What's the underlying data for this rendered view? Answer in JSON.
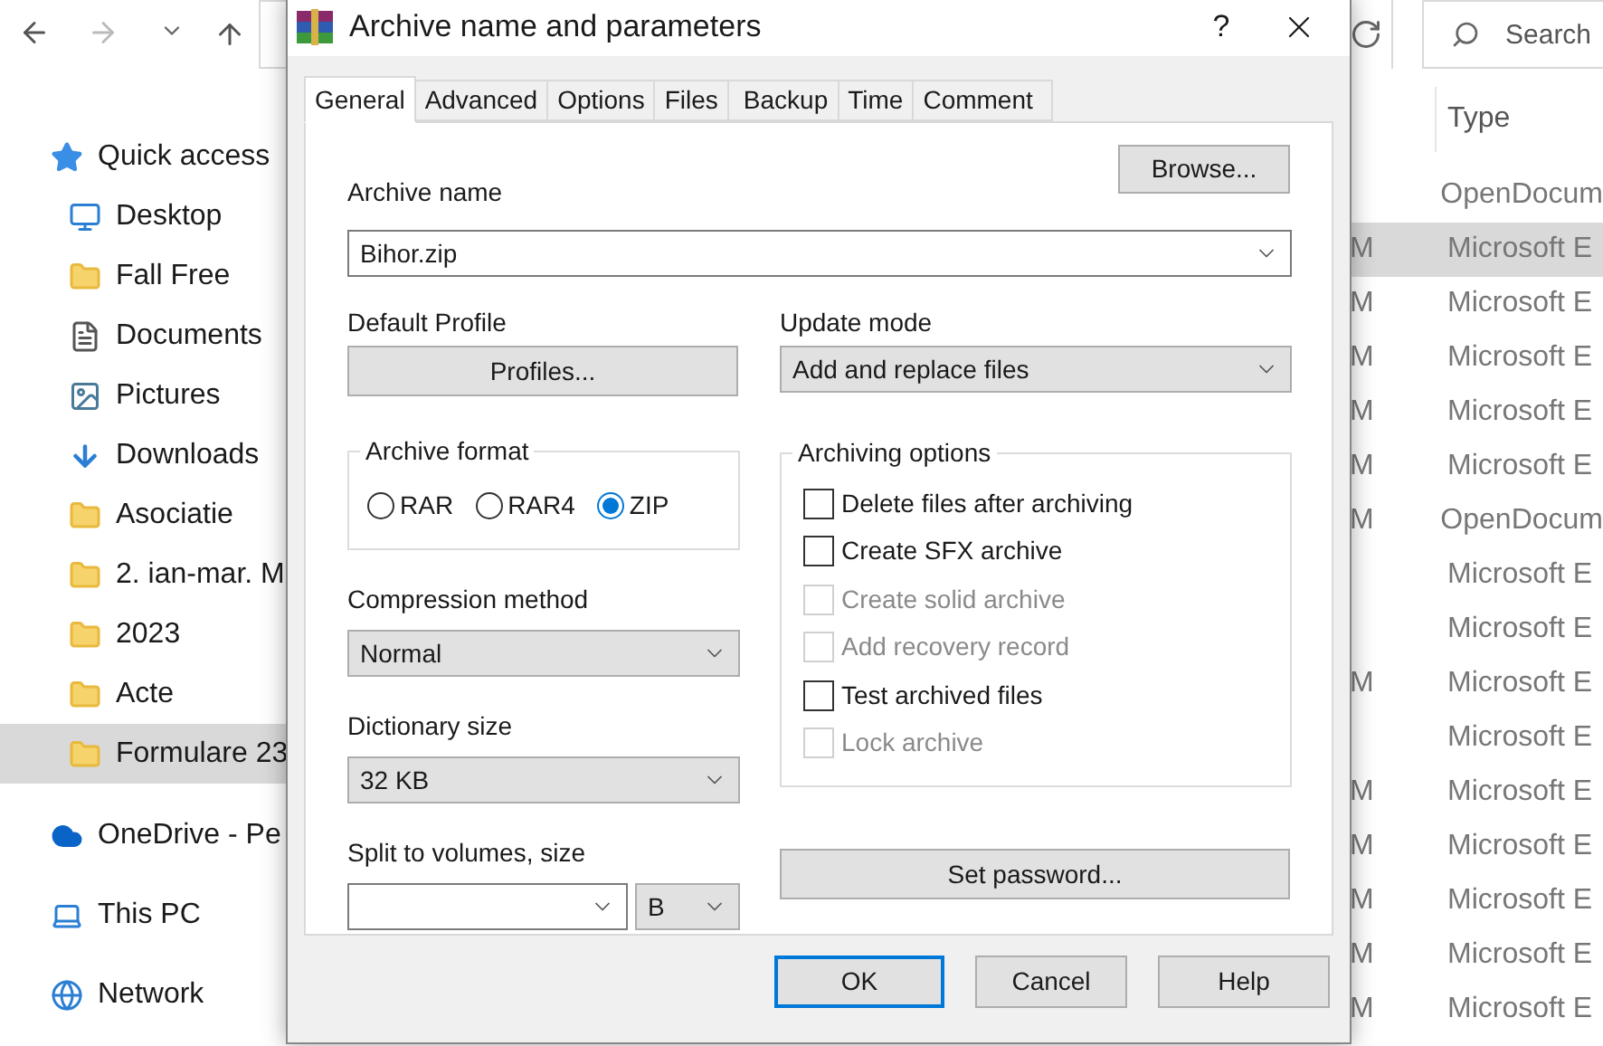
{
  "explorer": {
    "search": {
      "placeholder": "Search"
    },
    "nav": [
      {
        "label": "Quick access",
        "kind": "star",
        "selected": false
      },
      {
        "label": "Desktop",
        "kind": "desktop",
        "selected": false
      },
      {
        "label": "Fall Free",
        "kind": "folder",
        "selected": false
      },
      {
        "label": "Documents",
        "kind": "document",
        "selected": false
      },
      {
        "label": "Pictures",
        "kind": "pictures",
        "selected": false
      },
      {
        "label": "Downloads",
        "kind": "download",
        "selected": false
      },
      {
        "label": "Asociatie",
        "kind": "folder",
        "selected": false
      },
      {
        "label": "2. ian-mar. M",
        "kind": "folder",
        "selected": false
      },
      {
        "label": "2023",
        "kind": "folder",
        "selected": false
      },
      {
        "label": "Acte",
        "kind": "folder",
        "selected": false
      },
      {
        "label": "Formulare 23",
        "kind": "folder",
        "selected": true
      },
      {
        "label": "OneDrive - Pe",
        "kind": "cloud",
        "selected": false
      },
      {
        "label": "This PC",
        "kind": "pc",
        "selected": false
      },
      {
        "label": "Network",
        "kind": "network",
        "selected": false
      }
    ],
    "type_column": "Type",
    "rows": [
      {
        "type": "OpenDocum",
        "selected": false
      },
      {
        "date": "M",
        "type": "Microsoft E",
        "selected": true
      },
      {
        "date": "M",
        "type": "Microsoft E",
        "selected": false
      },
      {
        "date": "M",
        "type": "Microsoft E",
        "selected": false
      },
      {
        "date": "M",
        "type": "Microsoft E",
        "selected": false
      },
      {
        "date": "M",
        "type": "Microsoft E",
        "selected": false
      },
      {
        "date": "M",
        "type": "OpenDocum",
        "selected": false
      },
      {
        "type": "Microsoft E",
        "selected": false
      },
      {
        "type": "Microsoft E",
        "selected": false
      },
      {
        "date": "M",
        "type": "Microsoft E",
        "selected": false
      },
      {
        "type": "Microsoft E",
        "selected": false
      },
      {
        "date": "M",
        "type": "Microsoft E",
        "selected": false
      },
      {
        "date": "M",
        "type": "Microsoft E",
        "selected": false
      },
      {
        "date": "M",
        "type": "Microsoft E",
        "selected": false
      },
      {
        "date": "M",
        "type": "Microsoft E",
        "selected": false
      },
      {
        "date": "M",
        "type": "Microsoft E",
        "selected": false
      }
    ]
  },
  "dialog": {
    "title": "Archive name and parameters",
    "help": "?",
    "tabs": [
      {
        "label": "General",
        "selected": true
      },
      {
        "label": "Advanced",
        "selected": false
      },
      {
        "label": "Options",
        "selected": false
      },
      {
        "label": "Files",
        "selected": false
      },
      {
        "label": "Backup",
        "selected": false
      },
      {
        "label": "Time",
        "selected": false
      },
      {
        "label": "Comment",
        "selected": false
      }
    ],
    "archive_name": {
      "label": "Archive name",
      "value": "Bihor.zip",
      "browse": "Browse..."
    },
    "default_profile": {
      "label": "Default Profile",
      "button": "Profiles..."
    },
    "update_mode": {
      "label": "Update mode",
      "value": "Add and replace files"
    },
    "archive_format": {
      "label": "Archive format",
      "options": [
        {
          "label": "RAR",
          "selected": false
        },
        {
          "label": "RAR4",
          "selected": false
        },
        {
          "label": "ZIP",
          "selected": true
        }
      ]
    },
    "archiving_options": {
      "label": "Archiving options",
      "items": [
        {
          "label": "Delete files after archiving",
          "checked": false,
          "disabled": false
        },
        {
          "label": "Create SFX archive",
          "checked": false,
          "disabled": false
        },
        {
          "label": "Create solid archive",
          "checked": false,
          "disabled": true
        },
        {
          "label": "Add recovery record",
          "checked": false,
          "disabled": true
        },
        {
          "label": "Test archived files",
          "checked": false,
          "disabled": false
        },
        {
          "label": "Lock archive",
          "checked": false,
          "disabled": true
        }
      ]
    },
    "compression_method": {
      "label": "Compression method",
      "value": "Normal"
    },
    "dictionary_size": {
      "label": "Dictionary size",
      "value": "32 KB"
    },
    "split_volumes": {
      "label": "Split to volumes, size",
      "unit": "B"
    },
    "set_password": "Set password...",
    "buttons": [
      {
        "label": "OK",
        "default": true
      },
      {
        "label": "Cancel",
        "default": false
      },
      {
        "label": "Help",
        "default": false
      }
    ]
  }
}
